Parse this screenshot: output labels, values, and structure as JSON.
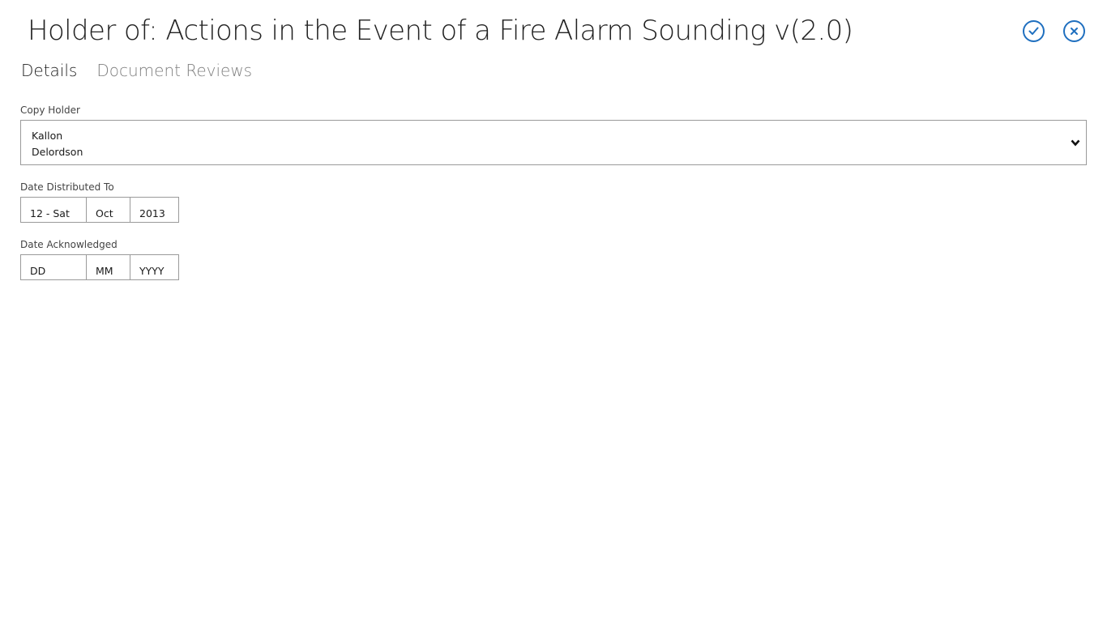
{
  "header": {
    "title": "Holder of: Actions in the Event of a Fire Alarm Sounding v(2.0)"
  },
  "tabs": [
    {
      "label": "Details",
      "active": true
    },
    {
      "label": "Document Reviews",
      "active": false
    }
  ],
  "copy_holder": {
    "label": "Copy Holder",
    "value_line1": "Kallon",
    "value_line2": "Delordson"
  },
  "date_distributed": {
    "label": "Date Distributed To",
    "day": "12 - Sat",
    "month": "Oct",
    "year": "2013"
  },
  "date_acknowledged": {
    "label": "Date Acknowledged",
    "day": "DD",
    "month": "MM",
    "year": "YYYY"
  },
  "colors": {
    "accent": "#1f6fbf",
    "border": "#9a9a9a",
    "inactive_tab": "#808080"
  },
  "icons": {
    "confirm": "checkmark-circle-icon",
    "close": "close-circle-icon",
    "dropdown": "chevron-down-icon"
  }
}
